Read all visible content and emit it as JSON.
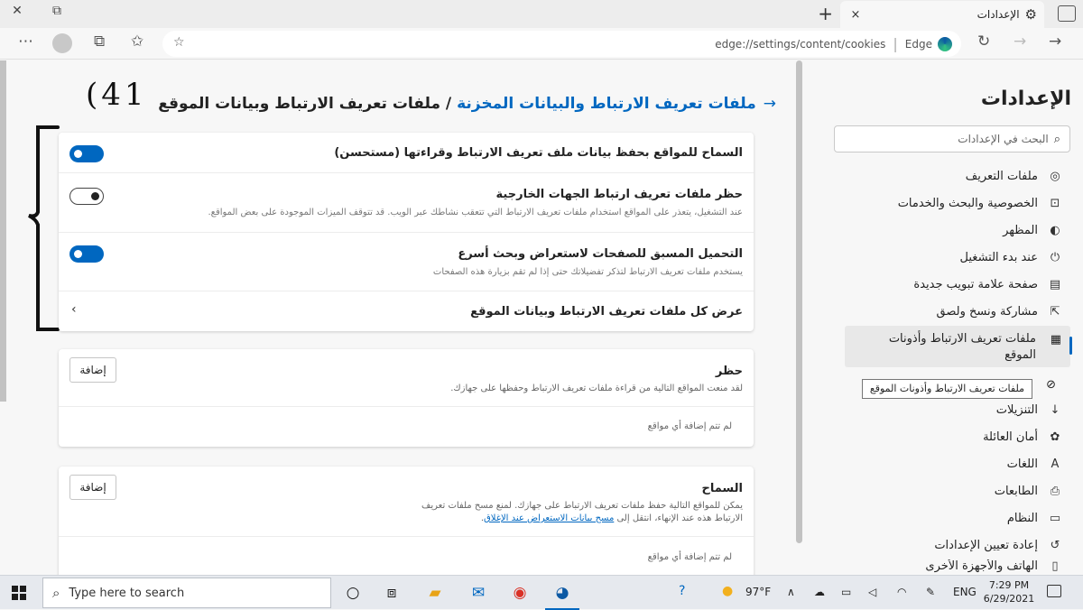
{
  "tab": {
    "title": "الإعدادات",
    "close": "×"
  },
  "window": {
    "new_tab": "+",
    "restore": "⧉",
    "close": "✕"
  },
  "address": {
    "url": "edge://settings/content/cookies",
    "browser_label": "Edge"
  },
  "sidebar": {
    "title": "الإعدادات",
    "search_placeholder": "البحث في الإعدادات",
    "items": [
      {
        "label": "ملفات التعريف",
        "icon": "profile-icon"
      },
      {
        "label": "الخصوصية والبحث والخدمات",
        "icon": "lock-icon"
      },
      {
        "label": "المظهر",
        "icon": "appearance-icon"
      },
      {
        "label": "عند بدء التشغيل",
        "icon": "power-icon"
      },
      {
        "label": "صفحة علامة تبويب جديدة",
        "icon": "new-tab-page-icon"
      },
      {
        "label": "مشاركة ونسخ ولصق",
        "icon": "share-icon"
      },
      {
        "label": "ملفات تعريف الارتباط وأذونات الموقع",
        "icon": "cookies-icon"
      },
      {
        "label": "التنزيلات",
        "icon": "download-icon"
      },
      {
        "label": "أمان العائلة",
        "icon": "family-icon"
      },
      {
        "label": "اللغات",
        "icon": "languages-icon"
      },
      {
        "label": "الطابعات",
        "icon": "printer-icon"
      },
      {
        "label": "النظام",
        "icon": "system-icon"
      },
      {
        "label": "إعادة تعيين الإعدادات",
        "icon": "reset-icon"
      },
      {
        "label": "الهاتف والأجهزة الأخرى",
        "icon": "phone-icon"
      }
    ],
    "tooltip": "ملفات تعريف الارتباط وأذونات الموقع"
  },
  "page": {
    "breadcrumb_parent": "ملفات تعريف الارتباط والبيانات المخزنة",
    "breadcrumb_sep": " / ",
    "breadcrumb_current": "ملفات تعريف الارتباط وبيانات الموقع",
    "handwritten_note": "(41"
  },
  "settings": {
    "allow_cookies": {
      "title": "السماح للمواقع بحفظ بيانات ملف تعريف الارتباط وقراءتها (مستحسن)",
      "on": true
    },
    "block_third_party": {
      "title": "حظر ملفات تعريف ارتباط الجهات الخارجية",
      "desc": "عند التشغيل، يتعذر على المواقع استخدام ملفات تعريف الارتباط التي تتعقب نشاطك عبر الويب. قد تتوقف الميزات الموجودة على بعض المواقع.",
      "on": false
    },
    "preload": {
      "title": "التحميل المسبق للصفحات لاستعراض وبحث أسرع",
      "desc": "يستخدم ملفات تعريف الارتباط لتذكر تفضيلاتك حتى إذا لم تقم بزيارة هذه الصفحات",
      "on": true
    },
    "see_all": {
      "title": "عرض كل ملفات تعريف الارتباط وبيانات الموقع"
    }
  },
  "block_section": {
    "title": "حظر",
    "desc": "لقد منعت المواقع التالية من قراءة ملفات تعريف الارتباط وحفظها على جهازك.",
    "add_label": "إضافة",
    "empty": "لم تتم إضافة أي مواقع"
  },
  "allow_section": {
    "title": "السماح",
    "desc_prefix": "يمكن للمواقع التالية حفظ ملفات تعريف الارتباط على جهازك. لمنع مسح ملفات تعريف الارتباط هذه عند الإنهاء، انتقل إلى ",
    "desc_link": "مسح بيانات الاستعراض عند الإغلاق",
    "desc_suffix": ".",
    "add_label": "إضافة",
    "empty": "لم تتم إضافة أي مواقع"
  },
  "taskbar": {
    "search_placeholder": "Type here to search",
    "weather": "97°F",
    "language": "ENG",
    "time": "7:29 PM",
    "date": "6/29/2021"
  },
  "colors": {
    "accent": "#0067c0",
    "page_bg": "#f7f7f7",
    "card_bg": "#ffffff"
  }
}
